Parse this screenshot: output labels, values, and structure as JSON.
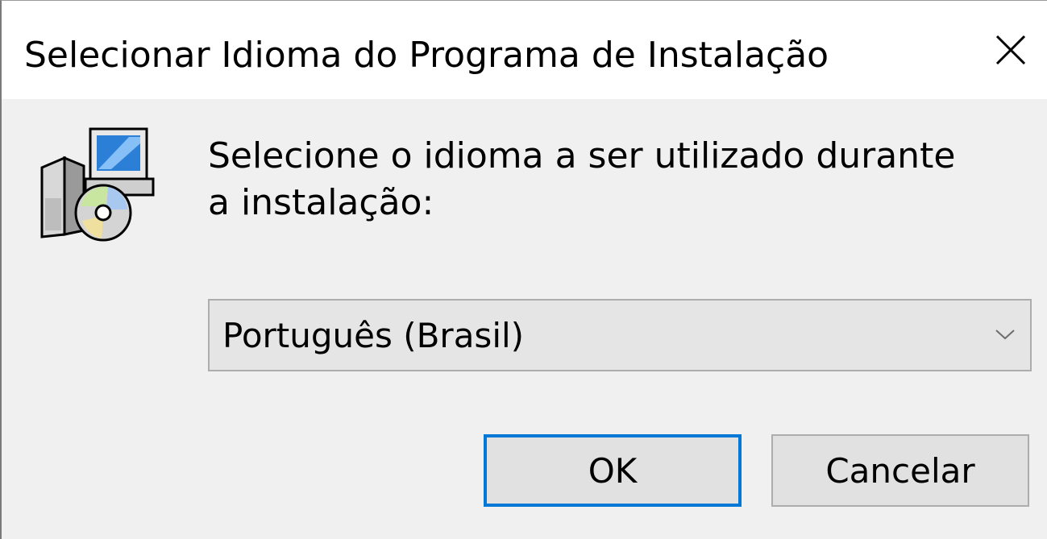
{
  "window": {
    "title": "Selecionar Idioma do Programa de Instalação"
  },
  "dialog": {
    "message": "Selecione o idioma a ser utilizado durante a instalação:",
    "language_select": {
      "selected": "Português (Brasil)"
    },
    "buttons": {
      "ok_label": "OK",
      "cancel_label": "Cancelar"
    }
  },
  "icons": {
    "close": "close-icon",
    "setup": "setup-installer-icon",
    "dropdown": "chevron-down-icon"
  },
  "colors": {
    "accent": "#0078d7",
    "background": "#f0f0f0",
    "titlebar": "#ffffff",
    "button_face": "#e1e1e1",
    "button_border": "#adadad"
  }
}
